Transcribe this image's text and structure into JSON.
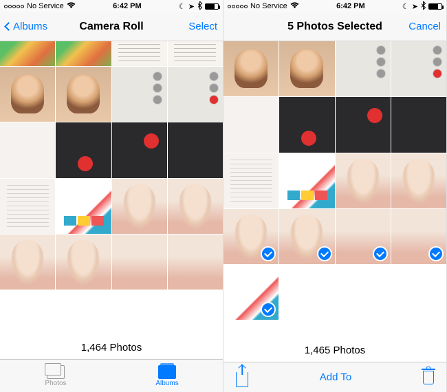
{
  "status": {
    "carrier": "No Service",
    "time": "6:42 PM"
  },
  "left": {
    "nav": {
      "back": "Albums",
      "title": "Camera Roll",
      "action": "Select"
    },
    "count": "1,464 Photos",
    "tabs": {
      "photos": "Photos",
      "albums": "Albums"
    }
  },
  "right": {
    "nav": {
      "title": "5 Photos Selected",
      "action": "Cancel"
    },
    "count": "1,465 Photos",
    "toolbar": {
      "addto": "Add To"
    }
  }
}
